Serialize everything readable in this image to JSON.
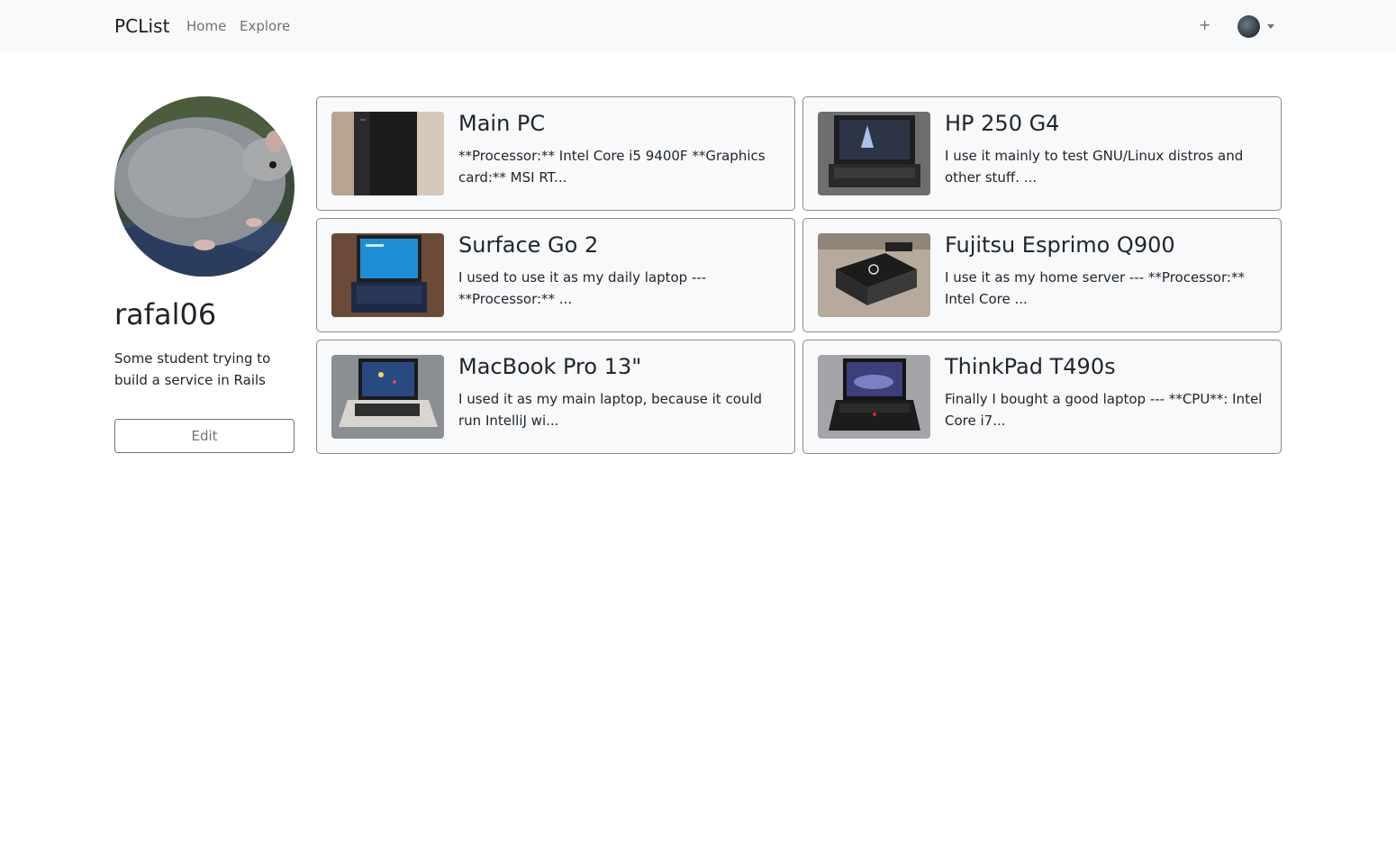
{
  "navbar": {
    "brand": "PCList",
    "links": [
      {
        "label": "Home"
      },
      {
        "label": "Explore"
      }
    ],
    "add_label": "+"
  },
  "profile": {
    "username": "rafal06",
    "bio": "Some student trying to build a service in Rails",
    "edit_label": "Edit"
  },
  "computers": [
    {
      "title": "Main PC",
      "description": "**Processor:** Intel Core i5 9400F **Graphics card:** MSI RT..."
    },
    {
      "title": "HP 250 G4",
      "description": "I use it mainly to test GNU/Linux distros and other stuff. ..."
    },
    {
      "title": "Surface Go 2",
      "description": "I used to use it as my daily laptop --- **Processor:** ..."
    },
    {
      "title": "Fujitsu Esprimo Q900",
      "description": "I use it as my home server --- **Processor:** Intel Core ..."
    },
    {
      "title": "MacBook Pro 13\"",
      "description": "I used it as my main laptop, because it could run IntelliJ wi..."
    },
    {
      "title": "ThinkPad T490s",
      "description": "Finally I bought a good laptop --- **CPU**: Intel Core i7..."
    }
  ]
}
